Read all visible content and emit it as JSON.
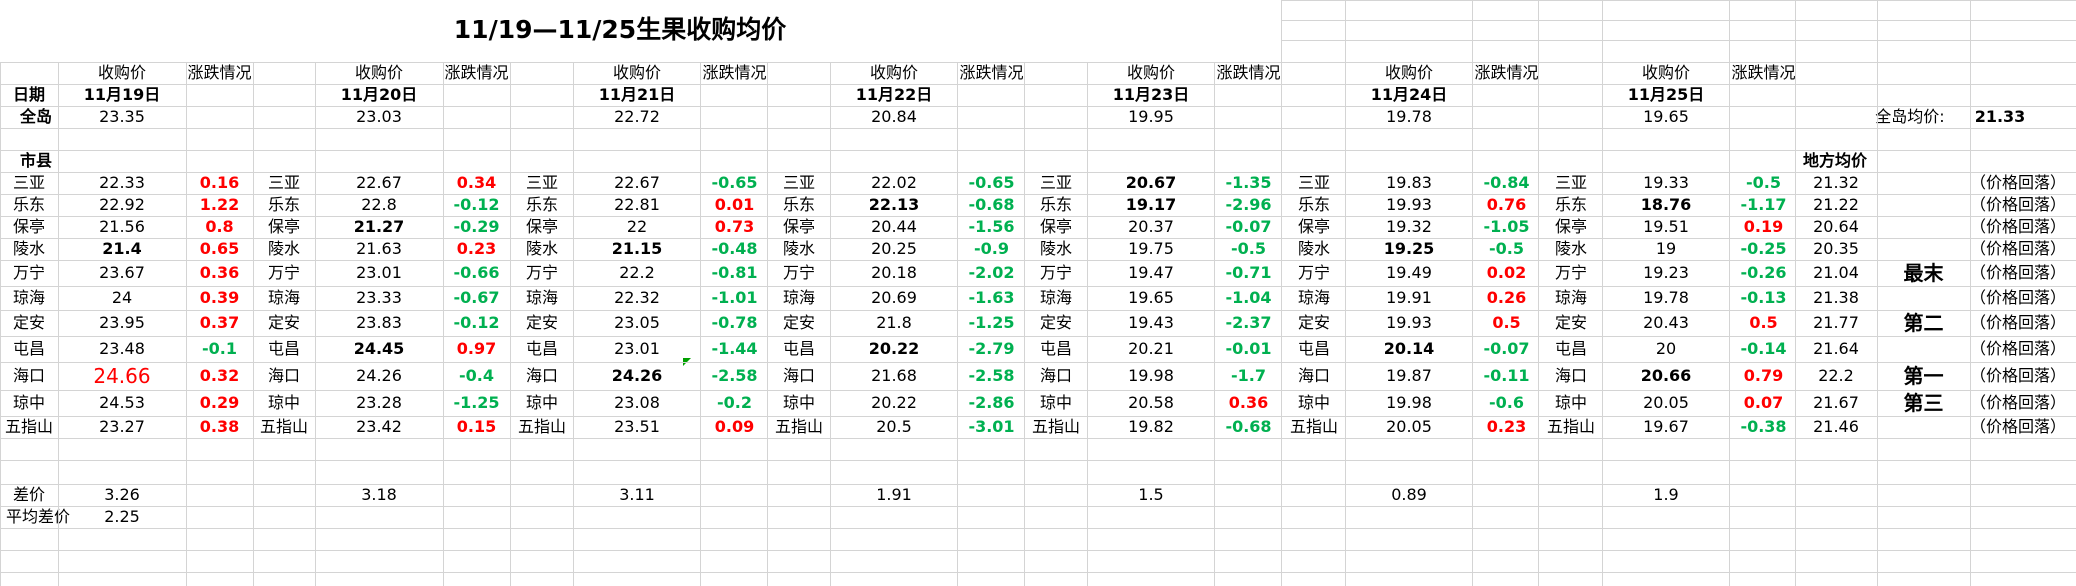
{
  "sheet": {
    "title": "11/19—11/25生果收购均价",
    "date_label": "日期",
    "island_label": "全岛",
    "county_header": "市县",
    "diff_label": "差价",
    "avg_diff_label": "平均差价",
    "avg_diff_value": "2.25",
    "island_avg_label": "全岛均价:",
    "island_avg_value": "21.33",
    "local_avg_header": "地方均价",
    "price_header": "收购价",
    "change_header": "涨跌情况"
  },
  "days": [
    {
      "date": "11月19日",
      "island": "23.35",
      "diff": "3.26",
      "rows": [
        {
          "county": "三亚",
          "price": "22.33",
          "change": "0.16",
          "change_color": "red"
        },
        {
          "county": "乐东",
          "price": "22.92",
          "change": "1.22",
          "change_color": "red"
        },
        {
          "county": "保亭",
          "price": "21.56",
          "change": "0.8",
          "change_color": "red"
        },
        {
          "county": "陵水",
          "price": "21.4",
          "price_bold": true,
          "change": "0.65",
          "change_color": "red"
        },
        {
          "county": "万宁",
          "price": "23.67",
          "change": "0.36",
          "change_color": "red"
        },
        {
          "county": "琼海",
          "price": "24",
          "change": "0.39",
          "change_color": "red"
        },
        {
          "county": "定安",
          "price": "23.95",
          "change": "0.37",
          "change_color": "red"
        },
        {
          "county": "屯昌",
          "price": "23.48",
          "change": "-0.1",
          "change_color": "green"
        },
        {
          "county": "海口",
          "price": "24.66",
          "price_red": true,
          "change": "0.32",
          "change_color": "red"
        },
        {
          "county": "琼中",
          "price": "24.53",
          "change": "0.29",
          "change_color": "red"
        },
        {
          "county": "五指山",
          "price": "23.27",
          "change": "0.38",
          "change_color": "red"
        }
      ]
    },
    {
      "date": "11月20日",
      "island": "23.03",
      "diff": "3.18",
      "rows": [
        {
          "county": "三亚",
          "price": "22.67",
          "change": "0.34",
          "change_color": "red"
        },
        {
          "county": "乐东",
          "price": "22.8",
          "change": "-0.12",
          "change_color": "green"
        },
        {
          "county": "保亭",
          "price": "21.27",
          "price_bold": true,
          "change": "-0.29",
          "change_color": "green"
        },
        {
          "county": "陵水",
          "price": "21.63",
          "change": "0.23",
          "change_color": "red"
        },
        {
          "county": "万宁",
          "price": "23.01",
          "change": "-0.66",
          "change_color": "green"
        },
        {
          "county": "琼海",
          "price": "23.33",
          "change": "-0.67",
          "change_color": "green"
        },
        {
          "county": "定安",
          "price": "23.83",
          "change": "-0.12",
          "change_color": "green"
        },
        {
          "county": "屯昌",
          "price": "24.45",
          "price_bold": true,
          "change": "0.97",
          "change_color": "red"
        },
        {
          "county": "海口",
          "price": "24.26",
          "change": "-0.4",
          "change_color": "green"
        },
        {
          "county": "琼中",
          "price": "23.28",
          "change": "-1.25",
          "change_color": "green"
        },
        {
          "county": "五指山",
          "price": "23.42",
          "change": "0.15",
          "change_color": "red"
        }
      ]
    },
    {
      "date": "11月21日",
      "island": "22.72",
      "diff": "3.11",
      "rows": [
        {
          "county": "三亚",
          "price": "22.67",
          "change": "-0.65",
          "change_color": "green"
        },
        {
          "county": "乐东",
          "price": "22.81",
          "change": "0.01",
          "change_color": "red"
        },
        {
          "county": "保亭",
          "price": "22",
          "change": "0.73",
          "change_color": "red"
        },
        {
          "county": "陵水",
          "price": "21.15",
          "price_bold": true,
          "change": "-0.48",
          "change_color": "green"
        },
        {
          "county": "万宁",
          "price": "22.2",
          "change": "-0.81",
          "change_color": "green"
        },
        {
          "county": "琼海",
          "price": "22.32",
          "change": "-1.01",
          "change_color": "green"
        },
        {
          "county": "定安",
          "price": "23.05",
          "change": "-0.78",
          "change_color": "green"
        },
        {
          "county": "屯昌",
          "price": "23.01",
          "change": "-1.44",
          "change_color": "green"
        },
        {
          "county": "海口",
          "price": "24.26",
          "price_bold": true,
          "change": "-2.58",
          "change_color": "green"
        },
        {
          "county": "琼中",
          "price": "23.08",
          "change": "-0.2",
          "change_color": "green"
        },
        {
          "county": "五指山",
          "price": "23.51",
          "change": "0.09",
          "change_color": "red"
        }
      ]
    },
    {
      "date": "11月22日",
      "island": "20.84",
      "diff": "1.91",
      "rows": [
        {
          "county": "三亚",
          "price": "22.02",
          "change": "-0.65",
          "change_color": "green"
        },
        {
          "county": "乐东",
          "price": "22.13",
          "price_bold": true,
          "change": "-0.68",
          "change_color": "green"
        },
        {
          "county": "保亭",
          "price": "20.44",
          "change": "-1.56",
          "change_color": "green"
        },
        {
          "county": "陵水",
          "price": "20.25",
          "change": "-0.9",
          "change_color": "green"
        },
        {
          "county": "万宁",
          "price": "20.18",
          "change": "-2.02",
          "change_color": "green"
        },
        {
          "county": "琼海",
          "price": "20.69",
          "change": "-1.63",
          "change_color": "green"
        },
        {
          "county": "定安",
          "price": "21.8",
          "change": "-1.25",
          "change_color": "green"
        },
        {
          "county": "屯昌",
          "price": "20.22",
          "price_bold": true,
          "change": "-2.79",
          "change_color": "green"
        },
        {
          "county": "海口",
          "price": "21.68",
          "change": "-2.58",
          "change_color": "green"
        },
        {
          "county": "琼中",
          "price": "20.22",
          "change": "-2.86",
          "change_color": "green"
        },
        {
          "county": "五指山",
          "price": "20.5",
          "change": "-3.01",
          "change_color": "green"
        }
      ]
    },
    {
      "date": "11月23日",
      "island": "19.95",
      "diff": "1.5",
      "rows": [
        {
          "county": "三亚",
          "price": "20.67",
          "price_bold": true,
          "change": "-1.35",
          "change_color": "green"
        },
        {
          "county": "乐东",
          "price": "19.17",
          "price_bold": true,
          "change": "-2.96",
          "change_color": "green"
        },
        {
          "county": "保亭",
          "price": "20.37",
          "change": "-0.07",
          "change_color": "green"
        },
        {
          "county": "陵水",
          "price": "19.75",
          "change": "-0.5",
          "change_color": "green"
        },
        {
          "county": "万宁",
          "price": "19.47",
          "change": "-0.71",
          "change_color": "green"
        },
        {
          "county": "琼海",
          "price": "19.65",
          "change": "-1.04",
          "change_color": "green"
        },
        {
          "county": "定安",
          "price": "19.43",
          "change": "-2.37",
          "change_color": "green"
        },
        {
          "county": "屯昌",
          "price": "20.21",
          "change": "-0.01",
          "change_color": "green"
        },
        {
          "county": "海口",
          "price": "19.98",
          "change": "-1.7",
          "change_color": "green"
        },
        {
          "county": "琼中",
          "price": "20.58",
          "change": "0.36",
          "change_color": "red"
        },
        {
          "county": "五指山",
          "price": "19.82",
          "change": "-0.68",
          "change_color": "green"
        }
      ]
    },
    {
      "date": "11月24日",
      "island": "19.78",
      "diff": "0.89",
      "rows": [
        {
          "county": "三亚",
          "price": "19.83",
          "change": "-0.84",
          "change_color": "green"
        },
        {
          "county": "乐东",
          "price": "19.93",
          "change": "0.76",
          "change_color": "red"
        },
        {
          "county": "保亭",
          "price": "19.32",
          "change": "-1.05",
          "change_color": "green"
        },
        {
          "county": "陵水",
          "price": "19.25",
          "price_bold": true,
          "change": "-0.5",
          "change_color": "green"
        },
        {
          "county": "万宁",
          "price": "19.49",
          "change": "0.02",
          "change_color": "red"
        },
        {
          "county": "琼海",
          "price": "19.91",
          "change": "0.26",
          "change_color": "red"
        },
        {
          "county": "定安",
          "price": "19.93",
          "change": "0.5",
          "change_color": "red"
        },
        {
          "county": "屯昌",
          "price": "20.14",
          "price_bold": true,
          "change": "-0.07",
          "change_color": "green"
        },
        {
          "county": "海口",
          "price": "19.87",
          "change": "-0.11",
          "change_color": "green"
        },
        {
          "county": "琼中",
          "price": "19.98",
          "change": "-0.6",
          "change_color": "green"
        },
        {
          "county": "五指山",
          "price": "20.05",
          "change": "0.23",
          "change_color": "red"
        }
      ]
    },
    {
      "date": "11月25日",
      "island": "19.65",
      "diff": "1.9",
      "rows": [
        {
          "county": "三亚",
          "price": "19.33",
          "change": "-0.5",
          "change_color": "green"
        },
        {
          "county": "乐东",
          "price": "18.76",
          "price_bold": true,
          "change": "-1.17",
          "change_color": "green"
        },
        {
          "county": "保亭",
          "price": "19.51",
          "change": "0.19",
          "change_color": "red"
        },
        {
          "county": "陵水",
          "price": "19",
          "change": "-0.25",
          "change_color": "green"
        },
        {
          "county": "万宁",
          "price": "19.23",
          "change": "-0.26",
          "change_color": "green"
        },
        {
          "county": "琼海",
          "price": "19.78",
          "change": "-0.13",
          "change_color": "green"
        },
        {
          "county": "定安",
          "price": "20.43",
          "change": "0.5",
          "change_color": "red"
        },
        {
          "county": "屯昌",
          "price": "20",
          "change": "-0.14",
          "change_color": "green"
        },
        {
          "county": "海口",
          "price": "20.66",
          "price_bold": true,
          "change": "0.79",
          "change_color": "red"
        },
        {
          "county": "琼中",
          "price": "20.05",
          "change": "0.07",
          "change_color": "red"
        },
        {
          "county": "五指山",
          "price": "19.67",
          "change": "-0.38",
          "change_color": "green"
        }
      ]
    }
  ],
  "local_avg": [
    {
      "avg": "21.32",
      "rank": "",
      "note": "（价格回落）"
    },
    {
      "avg": "21.22",
      "rank": "",
      "note": "（价格回落）"
    },
    {
      "avg": "20.64",
      "rank": "",
      "note": "（价格回落）"
    },
    {
      "avg": "20.35",
      "rank": "",
      "note": "（价格回落）"
    },
    {
      "avg": "21.04",
      "rank": "最末",
      "note": "（价格回落）"
    },
    {
      "avg": "21.38",
      "rank": "",
      "note": "（价格回落）"
    },
    {
      "avg": "21.77",
      "rank": "第二",
      "note": "（价格回落）"
    },
    {
      "avg": "21.64",
      "rank": "",
      "note": "（价格回落）"
    },
    {
      "avg": "22.2",
      "rank": "第一",
      "note": "（价格回落）"
    },
    {
      "avg": "21.67",
      "rank": "第三",
      "note": "（价格回落）"
    },
    {
      "avg": "21.46",
      "rank": "",
      "note": "（价格回落）"
    }
  ],
  "colors": {
    "up": "#ff0000",
    "down": "#00b050",
    "grid": "#d4d4d4"
  }
}
